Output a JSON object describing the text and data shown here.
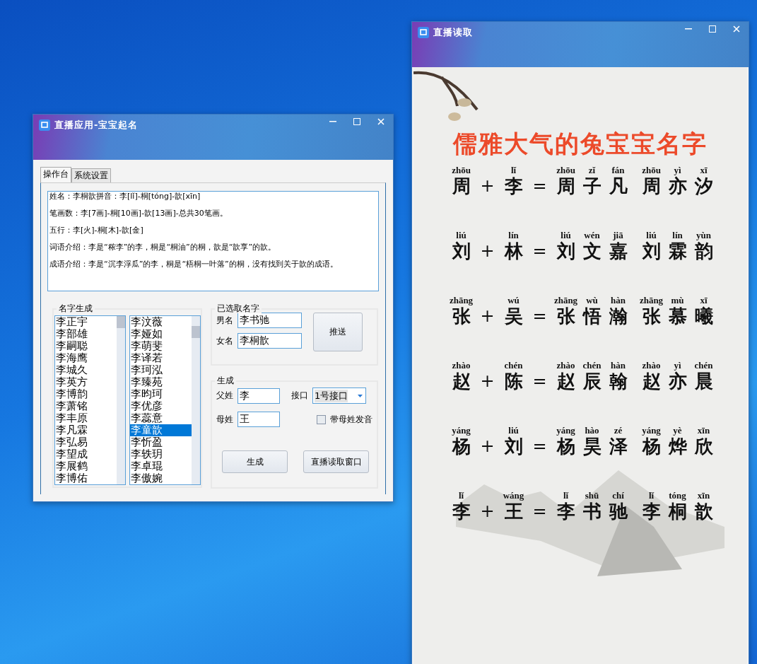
{
  "naming_window": {
    "title": "直播应用-宝宝起名",
    "tabs": [
      {
        "label": "操作台",
        "selected": true
      },
      {
        "label": "系统设置",
        "selected": false
      }
    ],
    "info_lines": [
      "姓名：李桐歆拼音：李[lǐ]-桐[tóng]-歆[xīn]",
      "笔画数：李[7画]-桐[10画]-歆[13画]-总共30笔画。",
      "五行：李[火]-桐[木]-歆[金]",
      "词语介绍：李是“秾李”的李，桐是“桐油”的桐，歆是“歆享”的歆。",
      "成语介绍：李是“沉李浮瓜”的李，桐是“梧桐一叶落”的桐，没有找到关于歆的成语。"
    ],
    "name_list_group": {
      "title": "名字生成",
      "list_1": [
        {
          "text": "李正宇",
          "selected": false
        },
        {
          "text": "李部雄",
          "selected": false
        },
        {
          "text": "李嗣聪",
          "selected": false
        },
        {
          "text": "李海鹰",
          "selected": false
        },
        {
          "text": "李城久",
          "selected": false
        },
        {
          "text": "李英方",
          "selected": false
        },
        {
          "text": "李博韵",
          "selected": false
        },
        {
          "text": "李萧铭",
          "selected": false
        },
        {
          "text": "李丰原",
          "selected": false
        },
        {
          "text": "李凡霖",
          "selected": false
        },
        {
          "text": "李弘易",
          "selected": false
        },
        {
          "text": "李望成",
          "selected": false
        },
        {
          "text": "李展鹤",
          "selected": false
        },
        {
          "text": "李博佑",
          "selected": false
        }
      ],
      "list_2": [
        {
          "text": "李汶薇",
          "selected": false
        },
        {
          "text": "李娅如",
          "selected": false
        },
        {
          "text": "李萌斐",
          "selected": false
        },
        {
          "text": "李译若",
          "selected": false
        },
        {
          "text": "李珂泓",
          "selected": false
        },
        {
          "text": "李臻苑",
          "selected": false
        },
        {
          "text": "李昀珂",
          "selected": false
        },
        {
          "text": "李优彦",
          "selected": false
        },
        {
          "text": "李蕊意",
          "selected": false
        },
        {
          "text": "李童歆",
          "selected": true
        },
        {
          "text": "李忻盈",
          "selected": false
        },
        {
          "text": "李轶玥",
          "selected": false
        },
        {
          "text": "李卓琨",
          "selected": false
        },
        {
          "text": "李傲婉",
          "selected": false
        }
      ]
    },
    "chosen_group": {
      "title": "已选取名字",
      "male_label": "男名",
      "male_value": "李书驰",
      "female_label": "女名",
      "female_value": "李桐歆",
      "push_button": "推送"
    },
    "generate_group": {
      "title": "生成",
      "father_label": "父姓",
      "father_value": "李",
      "port_label": "接口",
      "port_value": "1号接口",
      "mother_label": "母姓",
      "mother_value": "王",
      "checkbox": {
        "label": "带母姓发音",
        "checked": false
      },
      "buttons": [
        "生成",
        "直播读取窗口"
      ]
    }
  },
  "reader_window": {
    "title": "直播读取",
    "heading": "儒雅大气的兔宝宝名字",
    "rows": [
      {
        "father": {
          "pinyin": "zhōu",
          "char": "周"
        },
        "plus": "+",
        "mother": {
          "pinyin": "lǐ",
          "char": "李"
        },
        "equals": "=",
        "names": [
          [
            {
              "pinyin": "zhōu",
              "char": "周"
            },
            {
              "pinyin": "zǐ",
              "char": "子"
            },
            {
              "pinyin": "fán",
              "char": "凡"
            }
          ],
          [
            {
              "pinyin": "zhōu",
              "char": "周"
            },
            {
              "pinyin": "yì",
              "char": "亦"
            },
            {
              "pinyin": "xī",
              "char": "汐"
            }
          ]
        ]
      },
      {
        "father": {
          "pinyin": "liú",
          "char": "刘"
        },
        "plus": "+",
        "mother": {
          "pinyin": "lín",
          "char": "林"
        },
        "equals": "=",
        "names": [
          [
            {
              "pinyin": "liú",
              "char": "刘"
            },
            {
              "pinyin": "wén",
              "char": "文"
            },
            {
              "pinyin": "jiā",
              "char": "嘉"
            }
          ],
          [
            {
              "pinyin": "liú",
              "char": "刘"
            },
            {
              "pinyin": "lín",
              "char": "霖"
            },
            {
              "pinyin": "yùn",
              "char": "韵"
            }
          ]
        ]
      },
      {
        "father": {
          "pinyin": "zhāng",
          "char": "张"
        },
        "plus": "+",
        "mother": {
          "pinyin": "wú",
          "char": "吴"
        },
        "equals": "=",
        "names": [
          [
            {
              "pinyin": "zhāng",
              "char": "张"
            },
            {
              "pinyin": "wù",
              "char": "悟"
            },
            {
              "pinyin": "hàn",
              "char": "瀚"
            }
          ],
          [
            {
              "pinyin": "zhāng",
              "char": "张"
            },
            {
              "pinyin": "mù",
              "char": "慕"
            },
            {
              "pinyin": "xī",
              "char": "曦"
            }
          ]
        ]
      },
      {
        "father": {
          "pinyin": "zhào",
          "char": "赵"
        },
        "plus": "+",
        "mother": {
          "pinyin": "chén",
          "char": "陈"
        },
        "equals": "=",
        "names": [
          [
            {
              "pinyin": "zhào",
              "char": "赵"
            },
            {
              "pinyin": "chén",
              "char": "辰"
            },
            {
              "pinyin": "hàn",
              "char": "翰"
            }
          ],
          [
            {
              "pinyin": "zhào",
              "char": "赵"
            },
            {
              "pinyin": "yì",
              "char": "亦"
            },
            {
              "pinyin": "chén",
              "char": "晨"
            }
          ]
        ]
      },
      {
        "father": {
          "pinyin": "yáng",
          "char": "杨"
        },
        "plus": "+",
        "mother": {
          "pinyin": "liú",
          "char": "刘"
        },
        "equals": "=",
        "names": [
          [
            {
              "pinyin": "yáng",
              "char": "杨"
            },
            {
              "pinyin": "hào",
              "char": "昊"
            },
            {
              "pinyin": "zé",
              "char": "泽"
            }
          ],
          [
            {
              "pinyin": "yáng",
              "char": "杨"
            },
            {
              "pinyin": "yè",
              "char": "烨"
            },
            {
              "pinyin": "xīn",
              "char": "欣"
            }
          ]
        ]
      },
      {
        "father": {
          "pinyin": "lǐ",
          "char": "李"
        },
        "plus": "+",
        "mother": {
          "pinyin": "wáng",
          "char": "王"
        },
        "equals": "=",
        "names": [
          [
            {
              "pinyin": "lǐ",
              "char": "李"
            },
            {
              "pinyin": "shū",
              "char": "书"
            },
            {
              "pinyin": "chí",
              "char": "驰"
            }
          ],
          [
            {
              "pinyin": "lǐ",
              "char": "李"
            },
            {
              "pinyin": "tóng",
              "char": "桐"
            },
            {
              "pinyin": "xīn",
              "char": "歆"
            }
          ]
        ]
      }
    ]
  }
}
